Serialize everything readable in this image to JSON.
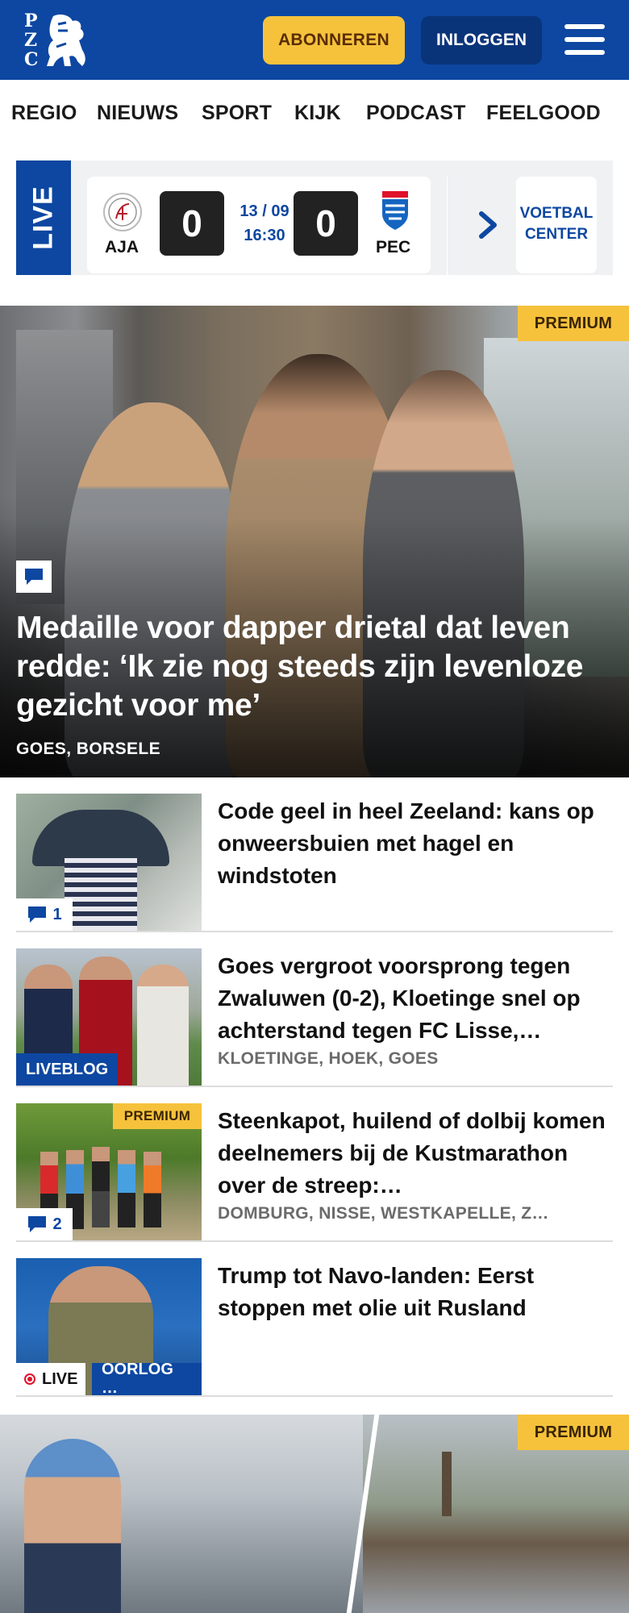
{
  "header": {
    "logo_letters": [
      "P",
      "Z",
      "C"
    ],
    "subscribe_label": "ABONNEREN",
    "login_label": "INLOGGEN",
    "accent": "#0d47a1",
    "subscribe_color": "#f6c23c"
  },
  "nav": {
    "items": [
      "REGIO",
      "NIEUWS",
      "SPORT",
      "KIJK",
      "PODCAST",
      "FEELGOOD"
    ]
  },
  "live": {
    "badge": "LIVE",
    "home_team": "AJA",
    "away_team": "PEC",
    "home_score": "0",
    "away_score": "0",
    "date": "13 / 09",
    "time": "16:30",
    "voetbal_line1": "VOETBAL",
    "voetbal_line2": "CENTER"
  },
  "hero": {
    "badge": "PREMIUM",
    "title": "Medaille voor dapper drietal dat leven redde: ‘Ik zie nog steeds zijn levenloze gezicht voor me’",
    "location": "GOES, BORSELE"
  },
  "articles": [
    {
      "title": "Code geel in heel Zeeland: kans op onweersbuien met hagel en windstoten",
      "location": "",
      "comments": "1"
    },
    {
      "title": "Goes vergroot voorsprong tegen Zwaluwen (0-2), Kloetinge snel op achterstand tegen FC Lisse,…",
      "location": "KLOETINGE, HOEK, GOES",
      "tag": "LIVEBLOG"
    },
    {
      "title": "Steenkapot, huilend of dolbij komen deelnemers bij de Kustmarathon over de streep:…",
      "location": "DOMBURG, NISSE, WESTKAPELLE, Z…",
      "badge": "PREMIUM",
      "comments": "2"
    },
    {
      "title": "Trump tot Navo-landen: Eerst stoppen met olie uit Rusland",
      "location": "",
      "live_label": "LIVE",
      "tag": "OORLOG …"
    }
  ],
  "hero2": {
    "badge": "PREMIUM"
  }
}
